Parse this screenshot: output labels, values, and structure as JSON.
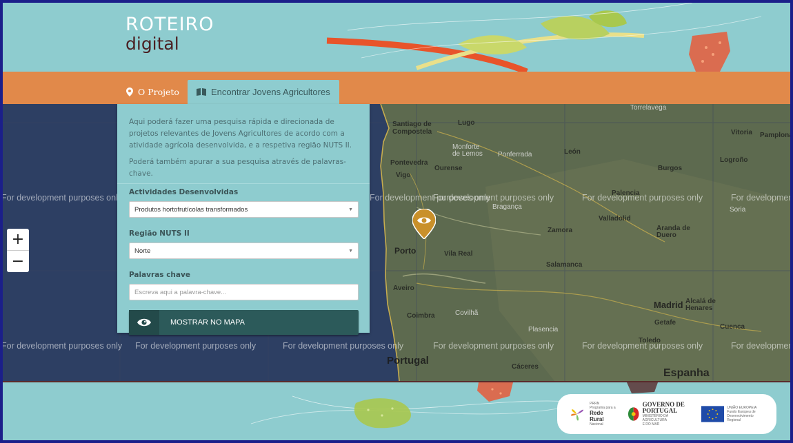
{
  "logo": {
    "line1": "ROTEIRO",
    "line2": "digital"
  },
  "nav": {
    "tabs": [
      {
        "label": "O Projeto",
        "icon": "map-pin-icon"
      },
      {
        "label": "Encontrar Jovens Agricultores",
        "icon": "book-icon"
      }
    ]
  },
  "search": {
    "intro": "Aqui poderá fazer uma pesquisa rápida e direcionada de projetos relevantes de Jovens Agricultores de acordo com a atividade agrícola desenvolvida, e a respetiva região NUTS II.",
    "intro2": "Poderá também apurar a sua pesquisa através de palavras-chave.",
    "activities_label": "Actividades Desenvolvidas",
    "activities_value": "Produtos hortofrutícolas transformados",
    "region_label": "Região NUTS II",
    "region_value": "Norte",
    "keywords_label": "Palavras chave",
    "keywords_placeholder": "Escreva aqui a palavra-chave...",
    "button_label": "MOSTRAR NO MAPA"
  },
  "map": {
    "zoom_in": "+",
    "zoom_out": "−",
    "watermarks": [
      "For development purposes only",
      "For development purposes only",
      "For development purposes only",
      "For development purposes only",
      "For development purposes only",
      "For development purposes only",
      "For development purposes only",
      "For development purposes only",
      "For development purposes only",
      "For development purposes only",
      "For development purposes only"
    ],
    "places": {
      "torrelavega": "Torrelavega",
      "santiago": "Santiago de Compostela",
      "lugo": "Lugo",
      "vitoria": "Vitoria",
      "pamplona": "Pamplona",
      "monforte": "Monforte de Lemos",
      "ponferrada": "Ponferrada",
      "leon": "León",
      "pontevedra": "Pontevedra",
      "ourense": "Ourense",
      "vigo": "Vigo",
      "burgos": "Burgos",
      "logrono": "Logroño",
      "palencia": "Palencia",
      "braganca": "Bragança",
      "soria": "Soria",
      "valladolid": "Valladolid",
      "zamora": "Zamora",
      "aranda": "Aranda de Duero",
      "porto": "Porto",
      "vilareal": "Vila Real",
      "salamanca": "Salamanca",
      "aveiro": "Aveiro",
      "madrid": "Madrid",
      "alcala": "Alcalá de Henares",
      "coimbra": "Coimbra",
      "covilha": "Covilhã",
      "getafe": "Getafe",
      "plasencia": "Plasencia",
      "cuenca": "Cuenca",
      "toledo": "Toledo",
      "portugal": "Portugal",
      "caceres": "Cáceres",
      "espanha": "Espanha"
    }
  },
  "footer": {
    "prr": {
      "small1": "PRRN",
      "small2": "Programa para a",
      "big": "Rede Rural",
      "small3": "Nacional"
    },
    "gov": {
      "big1": "GOVERNO DE",
      "big2": "PORTUGAL",
      "small1": "MINISTÉRIO DA AGRICULTURA",
      "small2": "E DO MAR"
    },
    "eu": {
      "small1": "UNIÃO EUROPEIA",
      "small2": "Fundo Europeu de",
      "small3": "Desenvolvimento Regional"
    }
  },
  "colors": {
    "header_bg": "#8ecccf",
    "nav_bg": "#e1894a",
    "map_sea": "#2d3f63",
    "button_bg": "#2c5a5a",
    "marker": "#c9902a"
  }
}
